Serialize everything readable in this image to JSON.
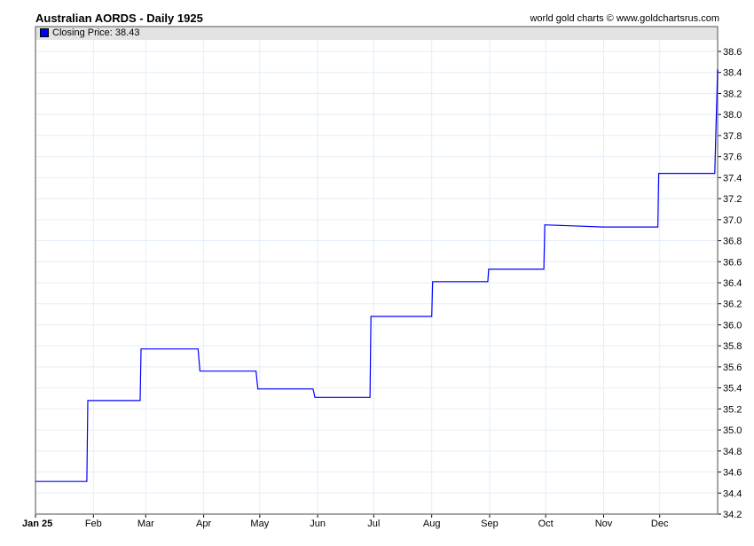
{
  "chart_data": {
    "type": "line",
    "title": "Australian AORDS - Daily 1925",
    "credit": "world gold charts © www.goldchartsrus.com",
    "legend": {
      "label": "Closing Price: 38.43",
      "color": "#0000ff",
      "placement": "top-left"
    },
    "xlabel": "",
    "ylabel": "",
    "x_unit": "day of year 1925",
    "xlim": [
      0,
      365
    ],
    "ylim": [
      34.2,
      38.7
    ],
    "grid": true,
    "x_ticks": [
      {
        "day": 0,
        "label": "Jan 25"
      },
      {
        "day": 31,
        "label": "Feb"
      },
      {
        "day": 59,
        "label": "Mar"
      },
      {
        "day": 90,
        "label": "Apr"
      },
      {
        "day": 120,
        "label": "May"
      },
      {
        "day": 151,
        "label": "Jun"
      },
      {
        "day": 181,
        "label": "Jul"
      },
      {
        "day": 212,
        "label": "Aug"
      },
      {
        "day": 243,
        "label": "Sep"
      },
      {
        "day": 273,
        "label": "Oct"
      },
      {
        "day": 304,
        "label": "Nov"
      },
      {
        "day": 334,
        "label": "Dec"
      }
    ],
    "y_ticks": [
      "34.2",
      "34.4",
      "34.6",
      "34.8",
      "35.0",
      "35.2",
      "35.4",
      "35.6",
      "35.8",
      "36.0",
      "36.2",
      "36.4",
      "36.6",
      "36.8",
      "37.0",
      "37.2",
      "37.4",
      "37.6",
      "37.8",
      "38.0",
      "38.2",
      "38.4",
      "38.6"
    ],
    "series": [
      {
        "name": "Closing Price",
        "color": "#0000ff",
        "points": [
          [
            0,
            34.51
          ],
          [
            27.5,
            34.51
          ],
          [
            28,
            35.28
          ],
          [
            56,
            35.28
          ],
          [
            56.5,
            35.77
          ],
          [
            87,
            35.77
          ],
          [
            88,
            35.56
          ],
          [
            118,
            35.56
          ],
          [
            119,
            35.39
          ],
          [
            148.5,
            35.39
          ],
          [
            149.5,
            35.31
          ],
          [
            179,
            35.31
          ],
          [
            179.5,
            36.08
          ],
          [
            212,
            36.08
          ],
          [
            212.5,
            36.41
          ],
          [
            242,
            36.41
          ],
          [
            242.5,
            36.53
          ],
          [
            272,
            36.53
          ],
          [
            272.5,
            36.95
          ],
          [
            304,
            36.93
          ],
          [
            333,
            36.93
          ],
          [
            333.5,
            37.44
          ],
          [
            363.5,
            37.44
          ],
          [
            364,
            37.8
          ],
          [
            365,
            38.43
          ]
        ]
      }
    ]
  }
}
